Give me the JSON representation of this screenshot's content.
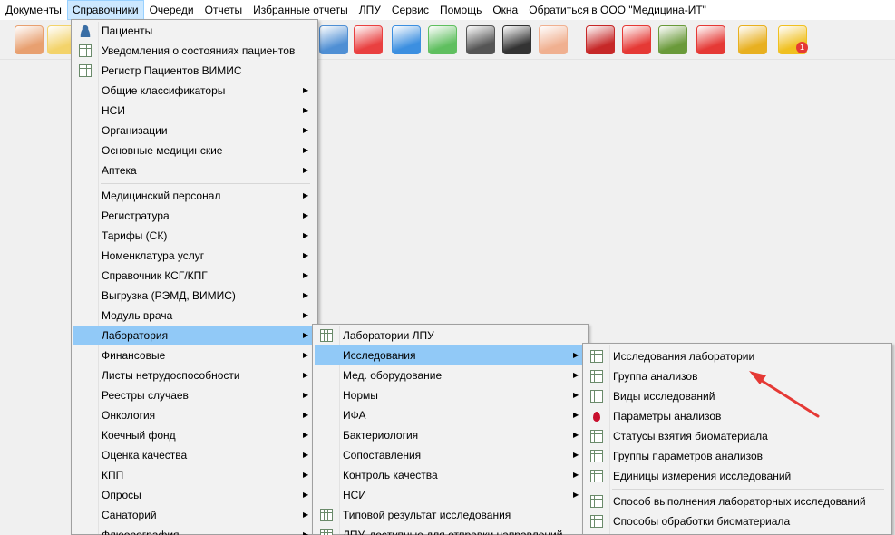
{
  "menubar": [
    "Документы",
    "Справочники",
    "Очереди",
    "Отчеты",
    "Избранные отчеты",
    "ЛПУ",
    "Сервис",
    "Помощь",
    "Окна",
    "Обратиться в ООО \"Медицина-ИТ\""
  ],
  "toolbar": [
    {
      "icon": "doctor-icon",
      "color": "#e8a070"
    },
    {
      "icon": "notebook-icon",
      "color": "#f3d36a"
    },
    {
      "icon": "medicine-bottles-icon",
      "color": "#4f8fd4"
    },
    {
      "icon": "first-aid-kit-icon",
      "color": "#e94040"
    },
    {
      "icon": "colored-cubes-icon",
      "color": "#3c8fe0"
    },
    {
      "icon": "pills-icon",
      "color": "#5fbf5f"
    },
    {
      "icon": "barcode-icon",
      "color": "#555555"
    },
    {
      "icon": "scanner-icon",
      "color": "#333333"
    },
    {
      "icon": "nurse-icon",
      "color": "#f0b090"
    },
    {
      "icon": "thermometer-icon",
      "color": "#d04040"
    },
    {
      "icon": "red-book-icon",
      "color": "#c62828"
    },
    {
      "icon": "calendar-icon",
      "color": "#e53935"
    },
    {
      "icon": "schedule-board-icon",
      "color": "#6a9a3a"
    },
    {
      "icon": "apps-grid-icon",
      "color": "#e53935"
    },
    {
      "icon": "lock-icon",
      "color": "#e8b020"
    },
    {
      "icon": "chat-notification-icon",
      "color": "#f0c020",
      "badge": "1"
    }
  ],
  "menu1": {
    "group1": [
      {
        "label": "Пациенты",
        "icon": "patient-icon"
      },
      {
        "label": "Уведомления о состояниях пациентов",
        "icon": "grid-icon"
      },
      {
        "label": "Регистр Пациентов ВИМИС",
        "icon": "table-icon"
      },
      {
        "label": "Общие классификаторы",
        "submenu": true
      },
      {
        "label": "НСИ",
        "submenu": true
      },
      {
        "label": "Организации",
        "submenu": true
      },
      {
        "label": "Основные медицинские",
        "submenu": true
      },
      {
        "label": "Аптека",
        "submenu": true
      }
    ],
    "group2": [
      {
        "label": "Медицинский персонал",
        "submenu": true
      },
      {
        "label": "Регистратура",
        "submenu": true
      },
      {
        "label": "Тарифы (СК)",
        "submenu": true
      },
      {
        "label": "Номенклатура услуг",
        "submenu": true
      },
      {
        "label": "Справочник КСГ/КПГ",
        "submenu": true
      },
      {
        "label": "Выгрузка (РЭМД, ВИМИС)",
        "submenu": true
      },
      {
        "label": "Модуль врача",
        "submenu": true
      },
      {
        "label": "Лаборатория",
        "submenu": true,
        "highlighted": true
      },
      {
        "label": "Финансовые",
        "submenu": true
      },
      {
        "label": "Листы нетрудоспособности",
        "submenu": true
      },
      {
        "label": "Реестры случаев",
        "submenu": true
      },
      {
        "label": "Онкология",
        "submenu": true
      },
      {
        "label": "Коечный фонд",
        "submenu": true
      },
      {
        "label": "Оценка качества",
        "submenu": true
      },
      {
        "label": "КПП",
        "submenu": true
      },
      {
        "label": "Опросы",
        "submenu": true
      },
      {
        "label": "Санаторий",
        "submenu": true
      },
      {
        "label": "Флюорография",
        "submenu": true
      }
    ]
  },
  "menu2": [
    {
      "label": "Лаборатории ЛПУ",
      "icon": "grid-icon"
    },
    {
      "label": "Исследования",
      "submenu": true,
      "highlighted": true
    },
    {
      "label": "Мед. оборудование",
      "submenu": true
    },
    {
      "label": "Нормы",
      "submenu": true
    },
    {
      "label": "ИФА",
      "submenu": true
    },
    {
      "label": "Бактериология",
      "submenu": true
    },
    {
      "label": "Сопоставления",
      "submenu": true
    },
    {
      "label": "Контроль качества",
      "submenu": true
    },
    {
      "label": "НСИ",
      "submenu": true
    },
    {
      "label": "Типовой результат исследования",
      "icon": "grid-icon"
    },
    {
      "label": "ЛПУ, доступные для отправки направлений",
      "icon": "table-icon"
    }
  ],
  "menu3": {
    "group1": [
      {
        "label": "Исследования лаборатории",
        "icon": "grid-icon"
      },
      {
        "label": "Группа анализов",
        "icon": "grid-icon"
      },
      {
        "label": "Виды исследований",
        "icon": "grid-icon"
      },
      {
        "label": "Параметры анализов",
        "icon": "blood-drop-icon"
      },
      {
        "label": "Статусы взятия биоматериала",
        "icon": "grid-icon"
      },
      {
        "label": "Группы параметров анализов",
        "icon": "grid-icon"
      },
      {
        "label": "Единицы измерения исследований",
        "icon": "grid-icon"
      }
    ],
    "group2": [
      {
        "label": "Способ выполнения лабораторных исследований",
        "icon": "grid-icon"
      },
      {
        "label": "Способы обработки биоматериала",
        "icon": "grid-icon"
      }
    ]
  },
  "colors": {
    "highlight": "#91c9f7",
    "menubar_active": "#cce8ff",
    "arrow": "#e53935"
  }
}
